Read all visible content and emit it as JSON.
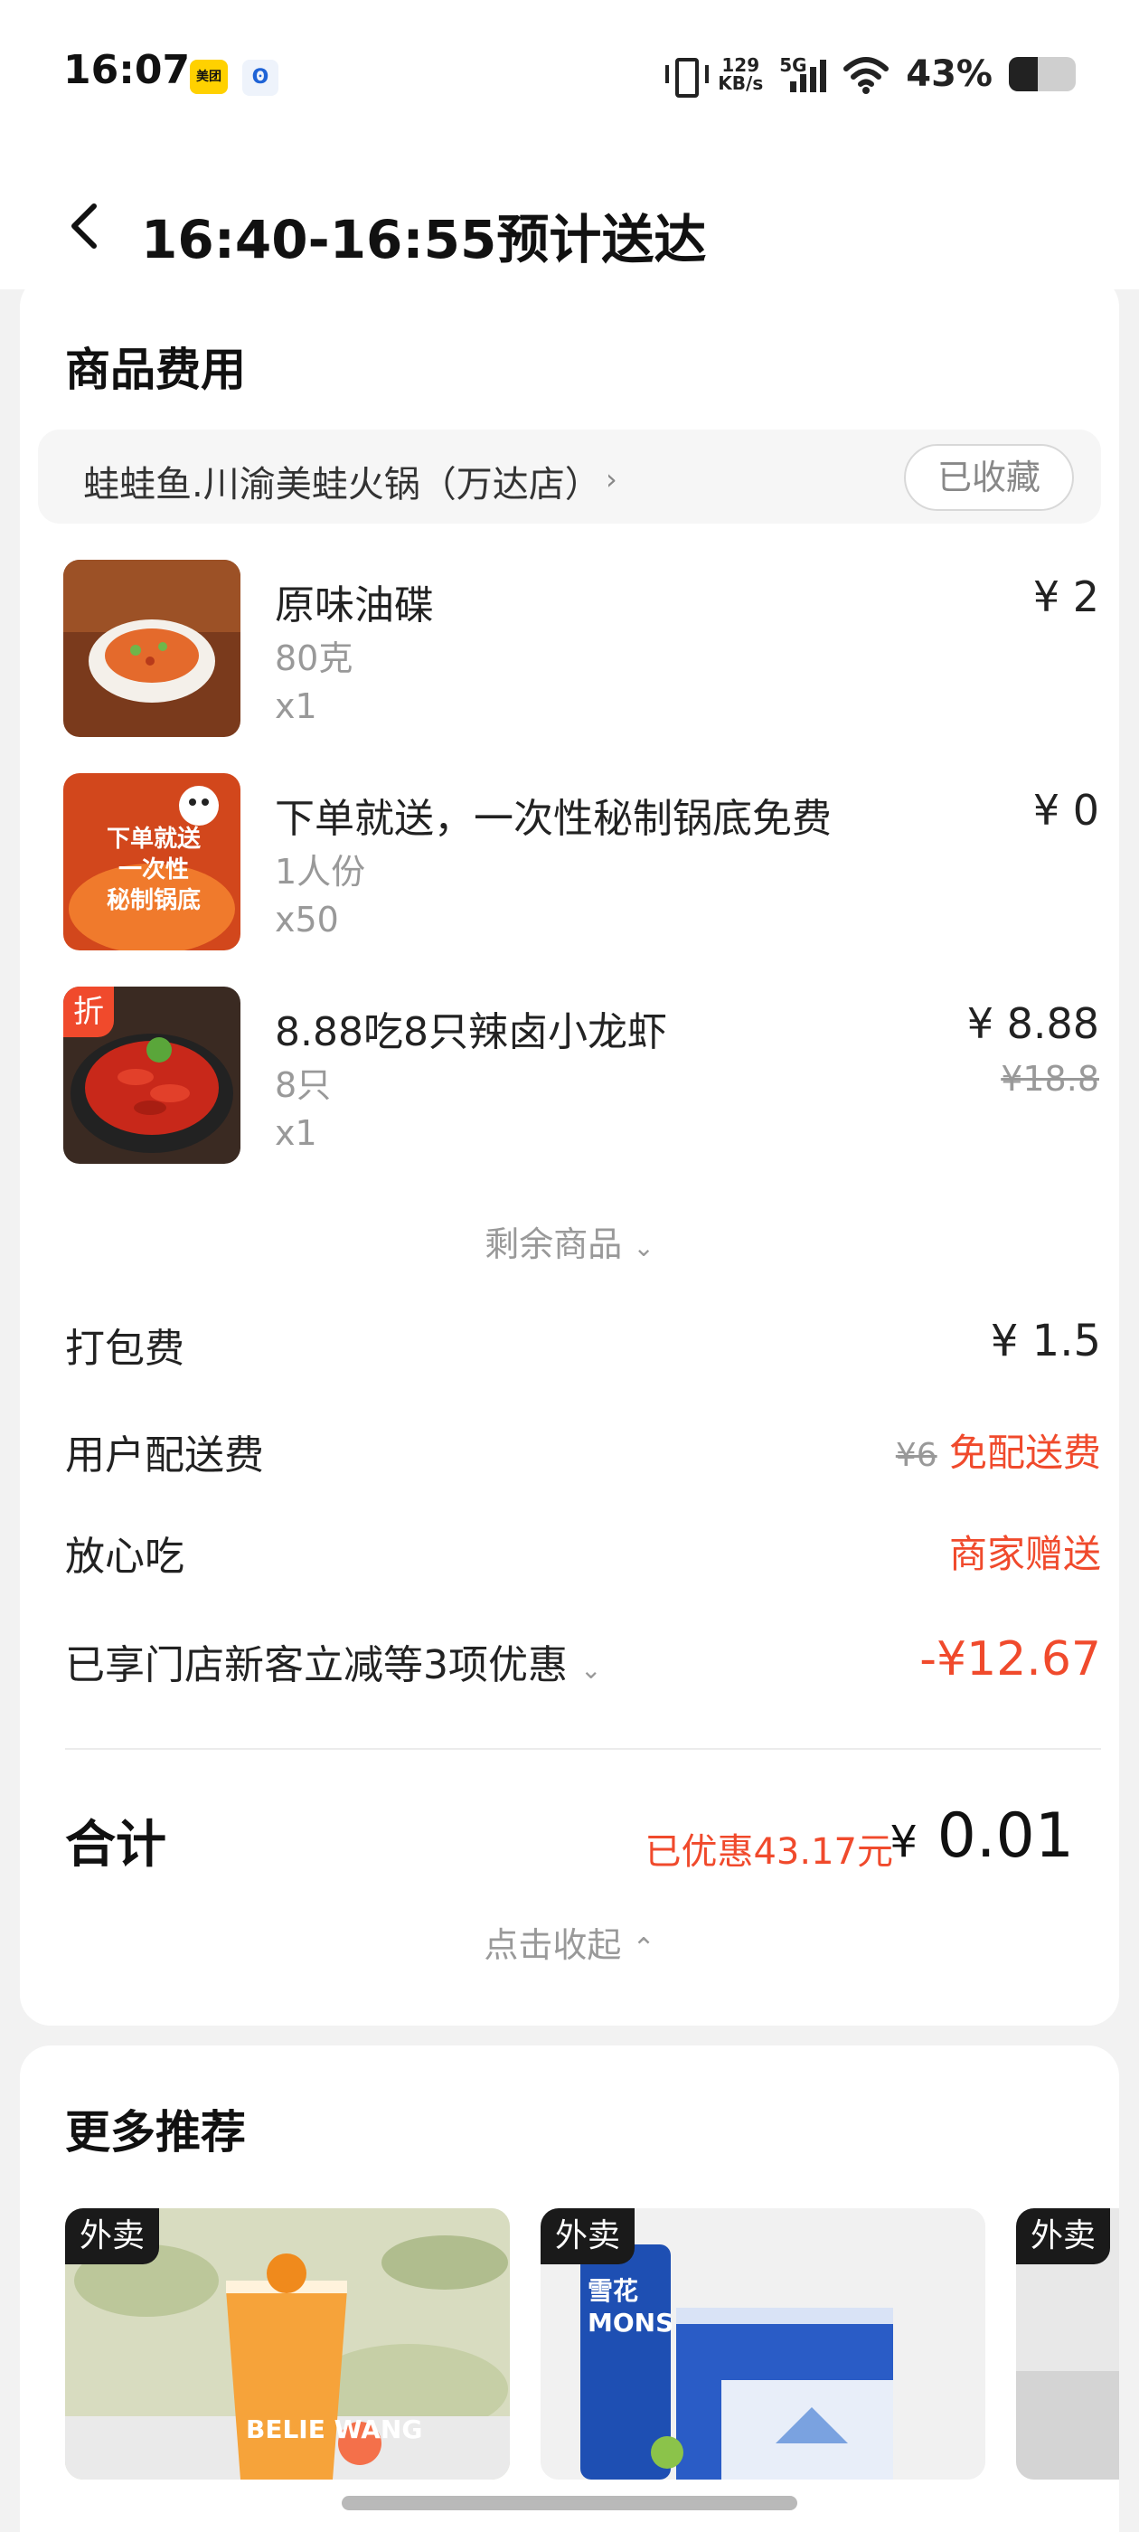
{
  "status_bar": {
    "time": "16:07",
    "meituan_badge": "美团",
    "app_icon_2": "ʘ",
    "net_speed_value": "129",
    "net_speed_unit": "KB/s",
    "network_type": "5G",
    "battery_percent": "43%",
    "battery_level": 0.43
  },
  "header": {
    "title": "16:40-16:55预计送达"
  },
  "fee_section": {
    "title": "商品费用",
    "store_name": "蛙蛙鱼.川渝美蛙火锅（万达店）",
    "favorite_label": "已收藏",
    "items": [
      {
        "name": "原味油碟",
        "spec": "80克",
        "qty": "x1",
        "price": "¥ 2",
        "orig_price": ""
      },
      {
        "name": "下单就送，一次性秘制锅底免费",
        "spec": "1人份",
        "qty": "x50",
        "price": "¥ 0",
        "orig_price": "",
        "thumb_text": "下单就送\n一次性\n秘制锅底"
      },
      {
        "name": "8.88吃8只辣卤小龙虾",
        "spec": "8只",
        "qty": "x1",
        "price": "¥ 8.88",
        "orig_price": "¥18.8",
        "tag": "折"
      }
    ],
    "more_items_label": "剩余商品",
    "packing_fee_label": "打包费",
    "packing_fee_value": "¥ 1.5",
    "delivery_fee_label": "用户配送费",
    "delivery_fee_orig": "¥6",
    "delivery_fee_value": "免配送费",
    "worry_free_label": "放心吃",
    "worry_free_value": "商家赠送",
    "discount_label": "已享门店新客立减等3项优惠",
    "discount_value": "-¥12.67",
    "total_label": "合计",
    "saved_text": "已优惠43.17元",
    "total_currency": "¥",
    "total_value": "0.01",
    "collapse_label": "点击收起"
  },
  "recommend": {
    "title": "更多推荐",
    "cards": [
      {
        "tag": "外卖",
        "thumb_text": "BELIE WANG"
      },
      {
        "tag": "外卖",
        "thumb_text": "雪花 MONS"
      },
      {
        "tag": "外卖"
      }
    ]
  },
  "colors": {
    "accent_red": "#f04a2c",
    "card_bg": "#ffffff",
    "page_bg": "#f2f2f2"
  }
}
